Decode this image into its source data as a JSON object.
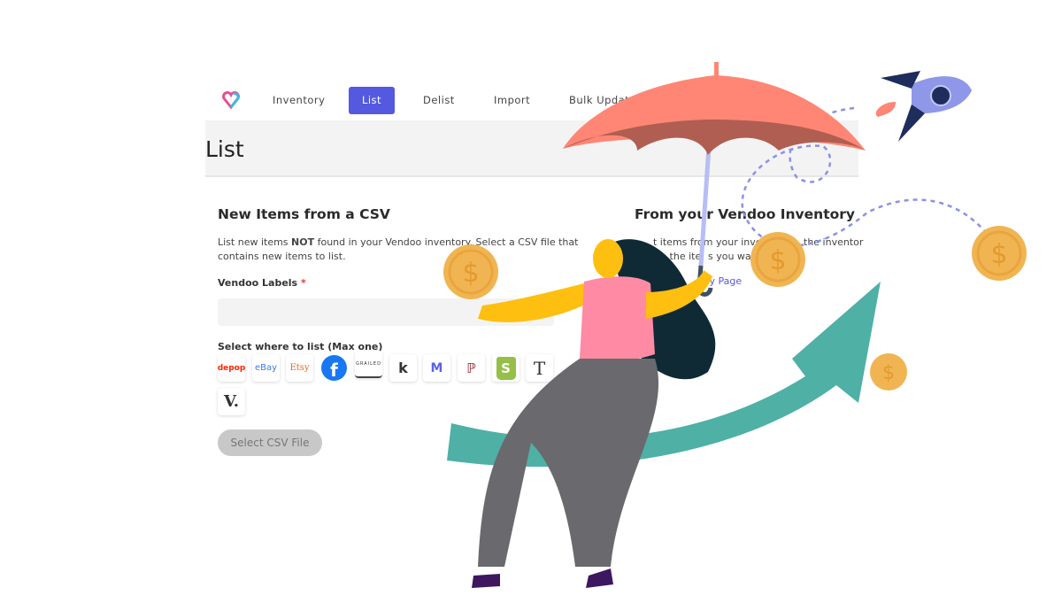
{
  "nav": {
    "items": [
      {
        "label": "Inventory"
      },
      {
        "label": "List",
        "active": true
      },
      {
        "label": "Delist"
      },
      {
        "label": "Import"
      },
      {
        "label": "Bulk Updat"
      }
    ]
  },
  "header": {
    "title": "List"
  },
  "csv": {
    "title": "New Items from a CSV",
    "desc_1": "List new items ",
    "desc_bold": "NOT",
    "desc_2": " found in your Vendoo inventory. Select a CSV file that",
    "desc_3": "contains new items to list.",
    "labels_label": "Vendoo Labels",
    "required": "*",
    "where_label": "Select where to list (Max one)",
    "button": "Select CSV File"
  },
  "marketplaces": [
    "depop",
    "eBay",
    "Etsy",
    "Facebook",
    "GRAILED",
    "Kidizen",
    "Mercari",
    "Poshmark",
    "Shopify",
    "Tradesy",
    "Vestiaire"
  ],
  "inventory": {
    "title": "From your Vendoo Inventory",
    "frag_1": "t items from your inven",
    "frag_2": "the inventor",
    "frag_3": "to the ite",
    "frag_4": "s you want",
    "link": "ry Page"
  },
  "colors": {
    "accent": "#5459e0",
    "umbrella": "#ff8674",
    "arrow": "#4fb0a5",
    "coin": "#f0b552",
    "rocket": "#1f2d5c"
  }
}
